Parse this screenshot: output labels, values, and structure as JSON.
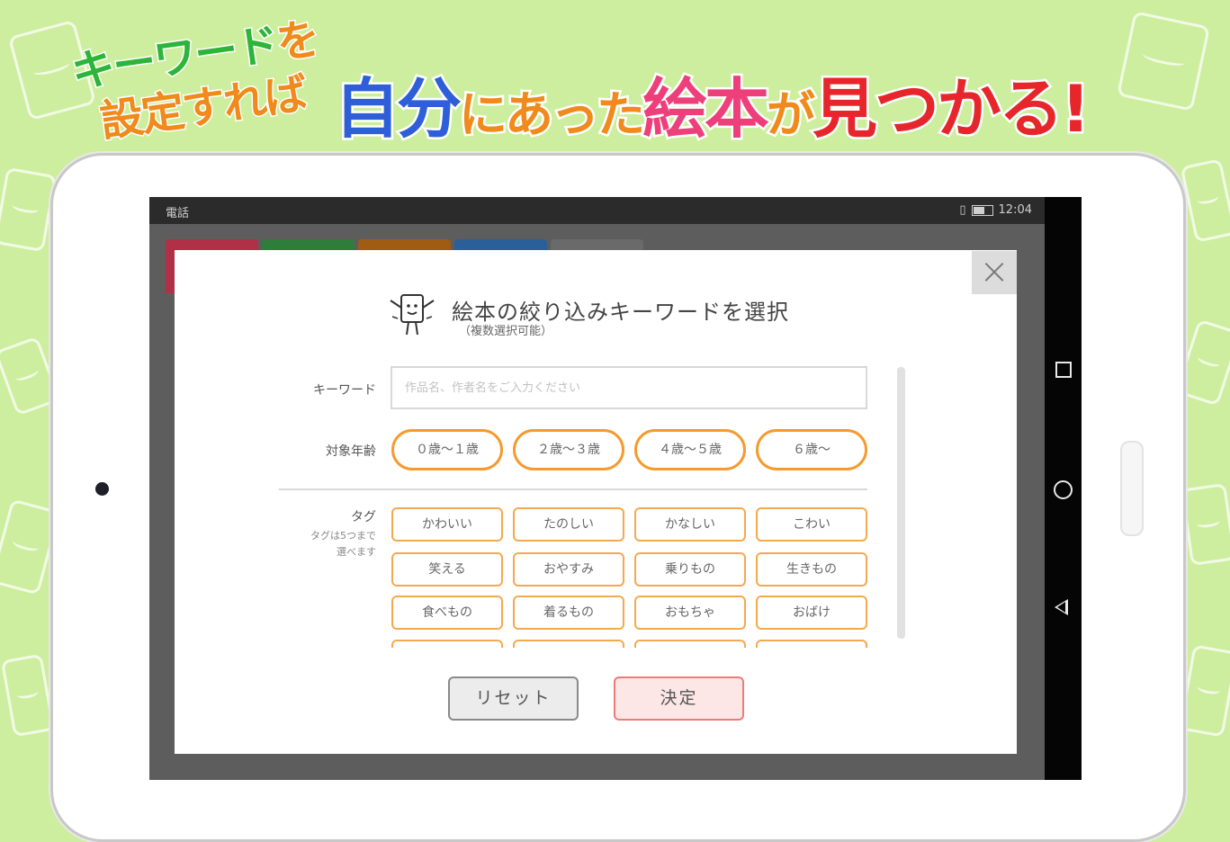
{
  "headline": {
    "keyword_line": "キーワード",
    "wo": "を",
    "set_line": "設定すれば",
    "main_parts": [
      {
        "text": "自分",
        "color": "#2f5fd8"
      },
      {
        "text": "にあった",
        "color": "#f08a1c"
      },
      {
        "text": "絵本",
        "color": "#ef3f7b"
      },
      {
        "text": "が",
        "color": "#f08a1c"
      },
      {
        "text": "見つかる!",
        "color": "#e6262a"
      }
    ]
  },
  "statusbar": {
    "left": "電話",
    "time": "12:04"
  },
  "background_tabs": [
    "#b03048",
    "#2e7d3a",
    "#a05c12",
    "#2a5f9a",
    "#6a6a6a"
  ],
  "modal": {
    "title": "絵本の絞り込みキーワードを選択",
    "subtitle": "（複数選択可能）",
    "close_label": "×",
    "keyword_label": "キーワード",
    "keyword_placeholder": "作品名、作者名をご入力ください",
    "keyword_value": "",
    "age_label": "対象年齢",
    "ages": [
      "０歳〜１歳",
      "２歳〜３歳",
      "４歳〜５歳",
      "６歳〜"
    ],
    "tag_label": "タグ",
    "tag_note_1": "タグは5つまで",
    "tag_note_2": "選べます",
    "tags": [
      [
        "かわいい",
        "たのしい",
        "かなしい",
        "こわい"
      ],
      [
        "笑える",
        "おやすみ",
        "乗りもの",
        "生きもの"
      ],
      [
        "食べもの",
        "着るもの",
        "おもちゃ",
        "おばけ"
      ],
      [
        "",
        "",
        "",
        ""
      ]
    ],
    "reset_label": "リセット",
    "ok_label": "決定"
  },
  "colors": {
    "background": "#cdee9e",
    "accent_orange": "#f59a2d",
    "ok_border": "#f07a7a"
  }
}
